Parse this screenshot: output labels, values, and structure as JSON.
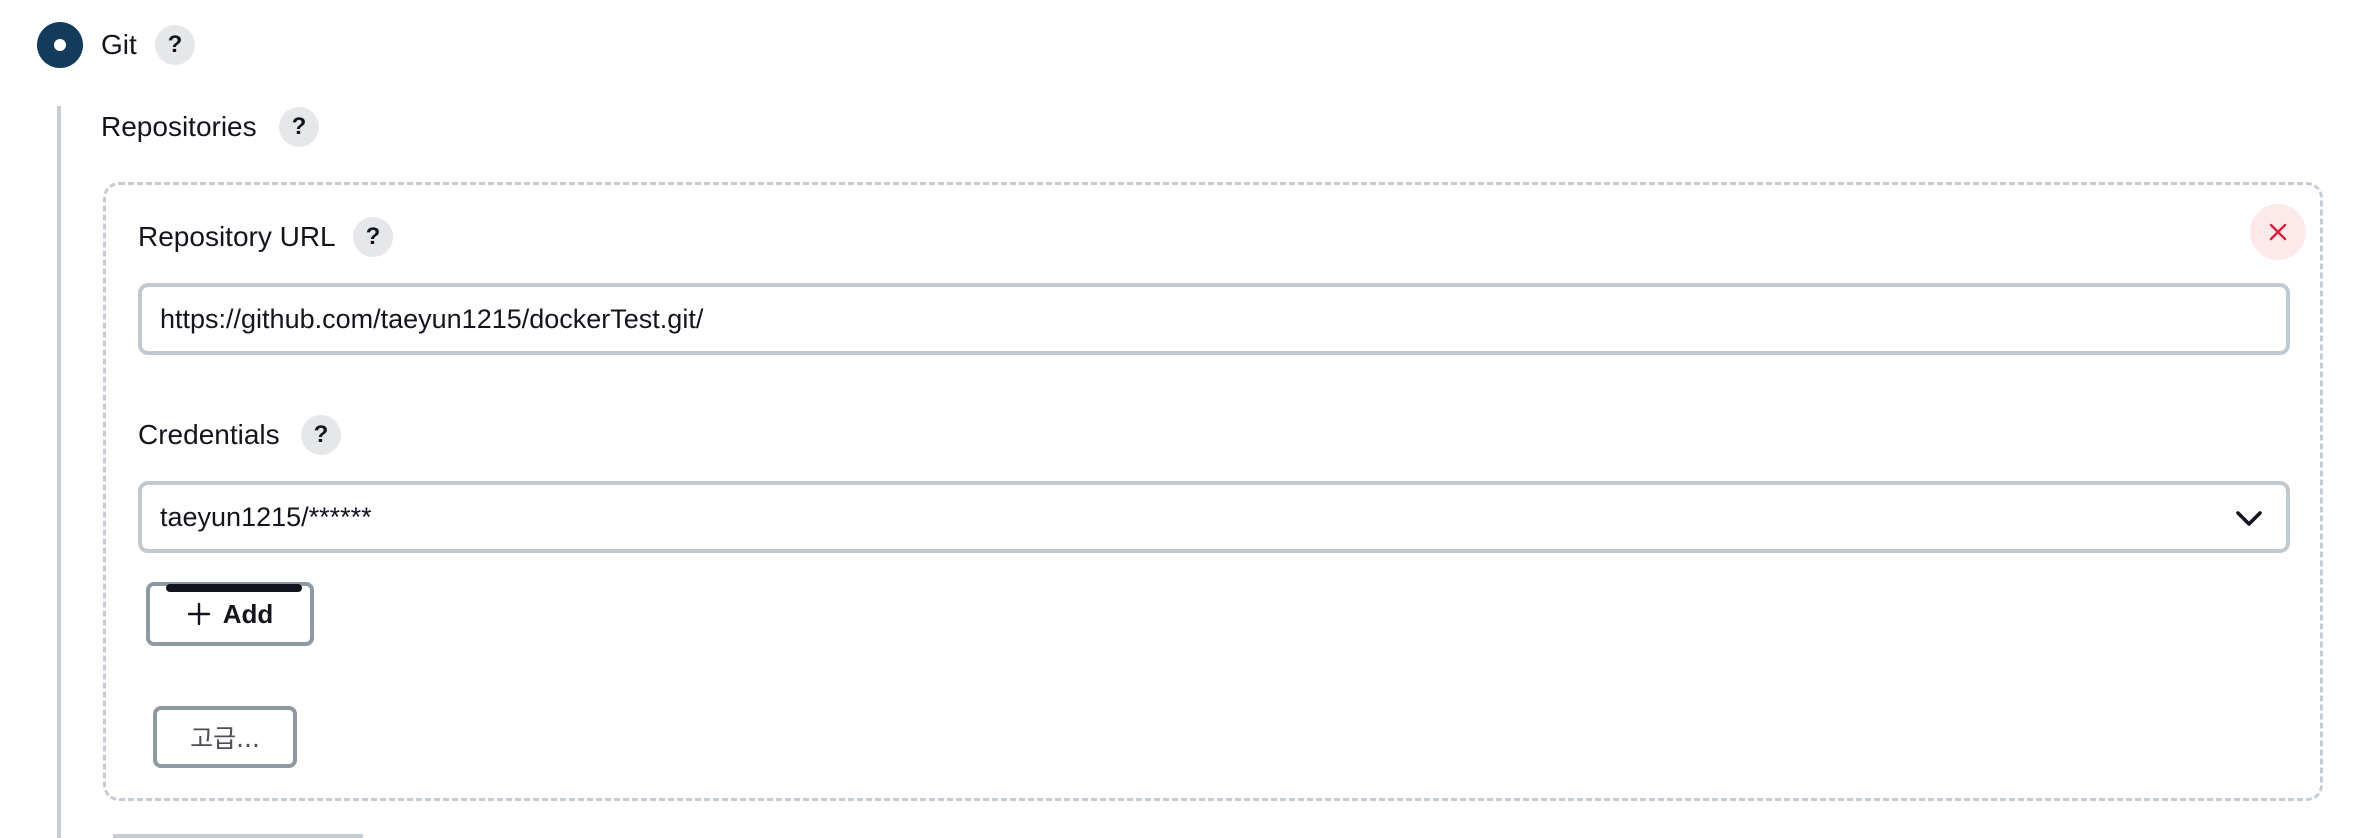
{
  "scm_option": {
    "label": "Git",
    "selected": true,
    "help": "?"
  },
  "repositories": {
    "label": "Repositories",
    "help": "?",
    "items": [
      {
        "url_label": "Repository URL",
        "url_help": "?",
        "url_value": "https://github.com/taeyun1215/dockerTest.git/",
        "credentials_label": "Credentials",
        "credentials_help": "?",
        "credentials_value": "taeyun1215/******",
        "add_label": "Add",
        "advanced_label": "고급..."
      }
    ]
  },
  "icons": {
    "radio": "radio-selected-icon",
    "remove": "close-icon",
    "dropdown": "chevron-down-icon",
    "add": "plus-icon"
  },
  "colors": {
    "radio_fill": "#123c5a",
    "remove_bg": "#fde8ea",
    "remove_icon": "#d0223a",
    "border": "#c0c8d0"
  }
}
